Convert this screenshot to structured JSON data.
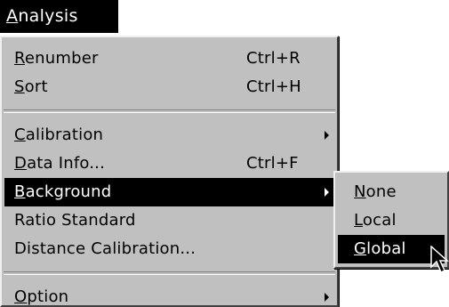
{
  "menu_title": {
    "mnemonic": "A",
    "rest": "nalysis"
  },
  "main_menu": {
    "items": [
      {
        "mnemonic": "R",
        "rest": "enumber",
        "shortcut": "Ctrl+R"
      },
      {
        "mnemonic": "S",
        "rest": "ort",
        "shortcut": "Ctrl+H"
      },
      {
        "mnemonic": "C",
        "rest": "alibration"
      },
      {
        "mnemonic": "D",
        "rest": "ata Info...",
        "shortcut": "Ctrl+F"
      },
      {
        "mnemonic": "B",
        "rest": "ackground"
      },
      {
        "pre": "Ratio Standard"
      },
      {
        "pre": "Distance Calibration..."
      },
      {
        "mnemonic": "O",
        "rest": "ption"
      }
    ]
  },
  "sub_menu": {
    "items": [
      {
        "mnemonic": "N",
        "rest": "one"
      },
      {
        "mnemonic": "L",
        "rest": "ocal"
      },
      {
        "mnemonic": "G",
        "rest": "lobal"
      }
    ]
  },
  "icons": {
    "submenu_arrow": "chevron-right-icon",
    "cursor": "mouse-pointer-icon"
  },
  "colors": {
    "menu_background": "#c0c0c0",
    "selection_background": "#000000",
    "selection_text": "#ffffff",
    "text": "#000000"
  }
}
